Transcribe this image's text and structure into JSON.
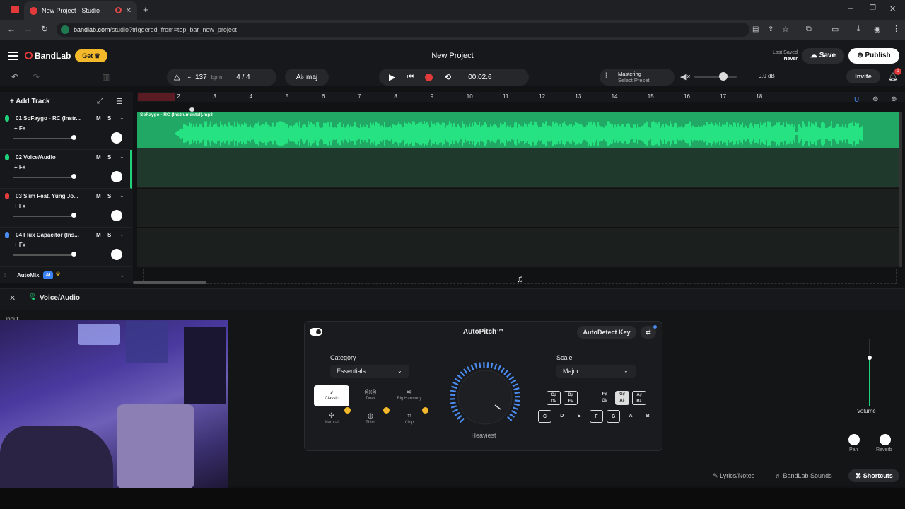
{
  "browser": {
    "tab_title": "New Project - Studio",
    "url_host": "bandlab.com",
    "url_path": "/studio?triggered_from=top_bar_new_project"
  },
  "header": {
    "logo": "BandLab",
    "get_label": "Get",
    "project_title": "New Project",
    "last_saved_label": "Last Saved",
    "last_saved_value": "Never",
    "save_label": "Save",
    "publish_label": "Publish"
  },
  "transport": {
    "bpm_value": "137",
    "bpm_unit": "bpm",
    "time_signature": "4 / 4",
    "key": "A♭ maj",
    "time": "00:02.6",
    "mastering_title": "Mastering",
    "mastering_sub": "Select Preset",
    "volume_db": "+0.0 dB",
    "volume_level": 0.7,
    "invite_label": "Invite",
    "notification_count": "1"
  },
  "tracklist": {
    "add_track_label": "Add Track",
    "fx_label": "+ Fx",
    "mute_label": "M",
    "solo_label": "S",
    "tracks": [
      {
        "name": "01  SoFaygo - RC (Instr...",
        "color": "#1fd17a"
      },
      {
        "name": "02  Voice/Audio",
        "color": "#1fd17a"
      },
      {
        "name": "03  Slim Feat. Yung Jo...",
        "color": "#e23a3a"
      },
      {
        "name": "04  Flux Capacitor (Ins...",
        "color": "#4a8cf0"
      }
    ],
    "automix_label": "AutoMix",
    "ai_badge": "AI"
  },
  "timeline": {
    "bars": [
      "1",
      "2",
      "3",
      "4",
      "5",
      "6",
      "7",
      "8",
      "9",
      "10",
      "11",
      "12",
      "13",
      "14",
      "15",
      "16",
      "17",
      "18"
    ],
    "clip_label": "SoFaygo - RC (Instrumental).mp3"
  },
  "editor": {
    "track_title": "Voice/Audio",
    "input_label": "Input",
    "effect_title": "AutoPitch™",
    "autodetect_label": "AutoDetect Key",
    "category_label": "Category",
    "category_value": "Essentials",
    "presets": [
      {
        "label": "Classic",
        "icon": "guitar-icon",
        "premium": false,
        "selected": true
      },
      {
        "label": "Duet",
        "icon": "duet-icon",
        "premium": false,
        "selected": false
      },
      {
        "label": "Big Harmony",
        "icon": "harmony-icon",
        "premium": false,
        "selected": false
      },
      {
        "label": "Natural",
        "icon": "natural-icon",
        "premium": true,
        "selected": false
      },
      {
        "label": "Third",
        "icon": "third-icon",
        "premium": true,
        "selected": false
      },
      {
        "label": "Chip",
        "icon": "chip-icon",
        "premium": true,
        "selected": false
      }
    ],
    "knob_label": "Heaviest",
    "scale_label": "Scale",
    "scale_value": "Major",
    "black_keys": [
      {
        "top": "C♯",
        "bottom": "D♭",
        "state": "on"
      },
      {
        "top": "D♯",
        "bottom": "E♭",
        "state": "on"
      },
      {
        "top": "F♯",
        "bottom": "G♭",
        "state": "off"
      },
      {
        "top": "G♯",
        "bottom": "A♭",
        "state": "fill"
      },
      {
        "top": "A♯",
        "bottom": "B♭",
        "state": "on"
      }
    ],
    "white_keys": [
      {
        "label": "C",
        "on": true
      },
      {
        "label": "D",
        "on": false
      },
      {
        "label": "E",
        "on": false
      },
      {
        "label": "F",
        "on": true
      },
      {
        "label": "G",
        "on": true
      },
      {
        "label": "A",
        "on": false
      },
      {
        "label": "B",
        "on": false
      }
    ],
    "volume_label": "Volume",
    "pan_label": "Pan",
    "reverb_label": "Reverb"
  },
  "footer": {
    "lyrics_label": "Lyrics/Notes",
    "sounds_label": "BandLab Sounds",
    "shortcuts_label": "Shortcuts"
  },
  "colors": {
    "accent_green": "#1fd17a",
    "record_red": "#e23a3a",
    "get_yellow": "#f3b92a",
    "knob_blue": "#4a8cf0"
  }
}
